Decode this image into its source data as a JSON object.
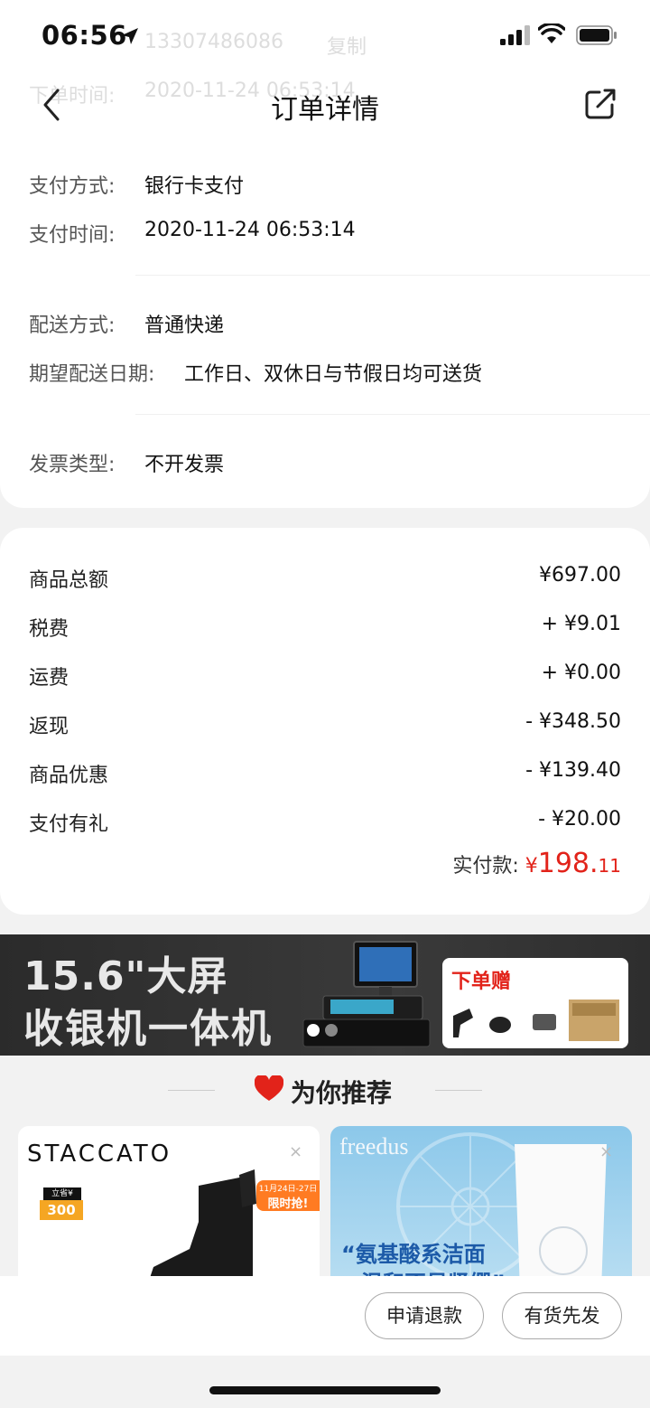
{
  "status": {
    "time": "06:56",
    "ghost_phone": "13307486086",
    "ghost_copy": "复制",
    "ghost_label": "下单时间:",
    "ghost_time": "2020-11-24 06:53:14"
  },
  "nav": {
    "title": "订单详情"
  },
  "order_info": {
    "pay_method_label": "支付方式:",
    "pay_method_value": "银行卡支付",
    "pay_time_label": "支付时间:",
    "pay_time_value": "2020-11-24 06:53:14",
    "delivery_label": "配送方式:",
    "delivery_value": "普通快递",
    "expected_label": "期望配送日期:",
    "expected_value": "工作日、双休日与节假日均可送货",
    "invoice_label": "发票类型:",
    "invoice_value": "不开发票"
  },
  "amounts": {
    "rows": [
      {
        "label": "商品总额",
        "value": "¥697.00"
      },
      {
        "label": "税费",
        "value": "+ ¥9.01"
      },
      {
        "label": "运费",
        "value": "+ ¥0.00"
      },
      {
        "label": "返现",
        "value": "- ¥348.50"
      },
      {
        "label": "商品优惠",
        "value": "- ¥139.40"
      },
      {
        "label": "支付有礼",
        "value": "- ¥20.00"
      }
    ],
    "paid_label": "实付款:",
    "paid_currency": "¥",
    "paid_int": "198.",
    "paid_dec": "11"
  },
  "banner": {
    "line1": "15.6\"大屏",
    "line2": "收银机一体机",
    "gift": "下单赠"
  },
  "recommend": {
    "title": "为你推荐",
    "product1_brand": "STACCATO",
    "product1_coupon_top": "立省¥",
    "product1_coupon_val": "300",
    "product1_date": "11月24日-27日",
    "product1_tag": "限时抢!",
    "product2_brand": "freedus",
    "product2_slogan1": "“氨基酸系洁面",
    "product2_slogan2": "温和不易紧绷”",
    "close": "×"
  },
  "actions": {
    "refund": "申请退款",
    "ship_first": "有货先发"
  },
  "colors": {
    "accent_red": "#e2231a",
    "banner_bg": "#2b2b2b"
  }
}
